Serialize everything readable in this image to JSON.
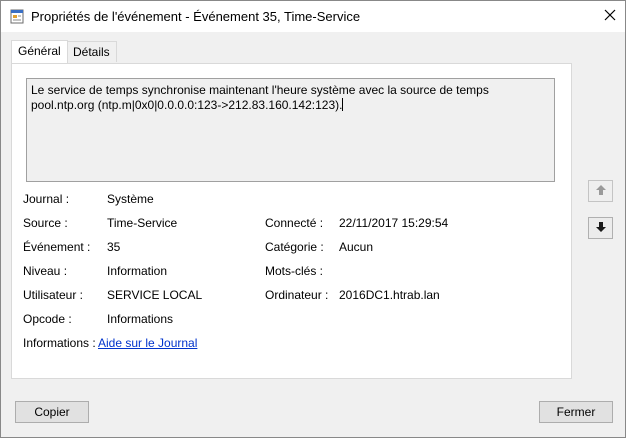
{
  "window": {
    "title": "Propriétés de l'événement - Événement 35, Time-Service"
  },
  "tabs": [
    {
      "label": "Général",
      "active": true
    },
    {
      "label": "Détails",
      "active": false
    }
  ],
  "description": "Le service de temps synchronise maintenant l'heure système avec la source de temps pool.ntp.org (ntp.m|0x0|0.0.0.0:123->212.83.160.142:123).",
  "properties": {
    "journal": {
      "label": "Journal :",
      "value": "Système"
    },
    "source": {
      "label": "Source :",
      "value": "Time-Service"
    },
    "evenement": {
      "label": "Événement :",
      "value": "35"
    },
    "niveau": {
      "label": "Niveau :",
      "value": "Information"
    },
    "utilisateur": {
      "label": "Utilisateur :",
      "value": "SERVICE LOCAL"
    },
    "opcode": {
      "label": "Opcode :",
      "value": "Informations"
    },
    "informations": {
      "label": "Informations :",
      "link": "Aide sur le Journal"
    },
    "connecte": {
      "label": "Connecté :",
      "value": "22/11/2017 15:29:54"
    },
    "categorie": {
      "label": "Catégorie :",
      "value": "Aucun"
    },
    "mots_cles": {
      "label": "Mots-clés :",
      "value": ""
    },
    "ordinateur": {
      "label": "Ordinateur :",
      "value": "2016DC1.htrab.lan"
    }
  },
  "buttons": {
    "copy": "Copier",
    "close": "Fermer"
  },
  "icons": {
    "title": "event-properties-icon",
    "close": "close-icon",
    "up": "arrow-up-icon",
    "down": "arrow-down-icon"
  },
  "colors": {
    "link": "#0033cc",
    "window_bg": "#f0f0f0",
    "panel_bg": "#ffffff"
  }
}
